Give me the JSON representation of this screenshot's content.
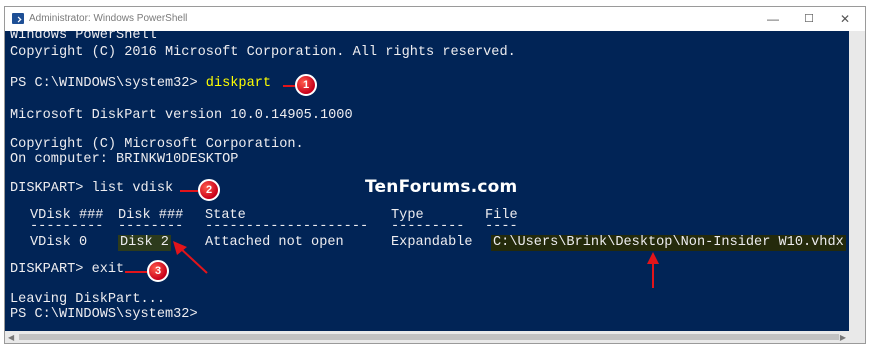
{
  "window": {
    "title": "Administrator: Windows PowerShell",
    "min_glyph": "—",
    "max_glyph": "☐",
    "close_glyph": "✕"
  },
  "console": {
    "l1": "Windows PowerShell",
    "l2": "Copyright (C) 2016 Microsoft Corporation. All rights reserved.",
    "prompt1": "PS C:\\WINDOWS\\system32> ",
    "cmd1": "diskpart",
    "l4": "Microsoft DiskPart version 10.0.14905.1000",
    "l5": "Copyright (C) Microsoft Corporation.",
    "l6": "On computer: BRINKW10DESKTOP",
    "prompt2": "DISKPART> ",
    "cmd2": "list vdisk",
    "table": {
      "headers": [
        "VDisk ###",
        "Disk ###",
        "State",
        "Type",
        "File"
      ],
      "dashes": [
        "---------",
        "--------",
        "--------------------",
        "---------",
        "----"
      ],
      "row": [
        "VDisk 0",
        "Disk 2",
        "Attached not open",
        "Expandable",
        "C:\\Users\\Brink\\Desktop\\Non-Insider W10.vhdx"
      ]
    },
    "prompt3": "DISKPART> ",
    "cmd3": "exit",
    "l9": "Leaving DiskPart...",
    "l10": "PS C:\\WINDOWS\\system32>"
  },
  "markers": [
    "1",
    "2",
    "3"
  ],
  "watermark": "TenForums.com",
  "colors": {
    "console_bg": "#012456",
    "text": "#eeedf0",
    "command": "#ffff00",
    "marker": "#e2141a"
  }
}
